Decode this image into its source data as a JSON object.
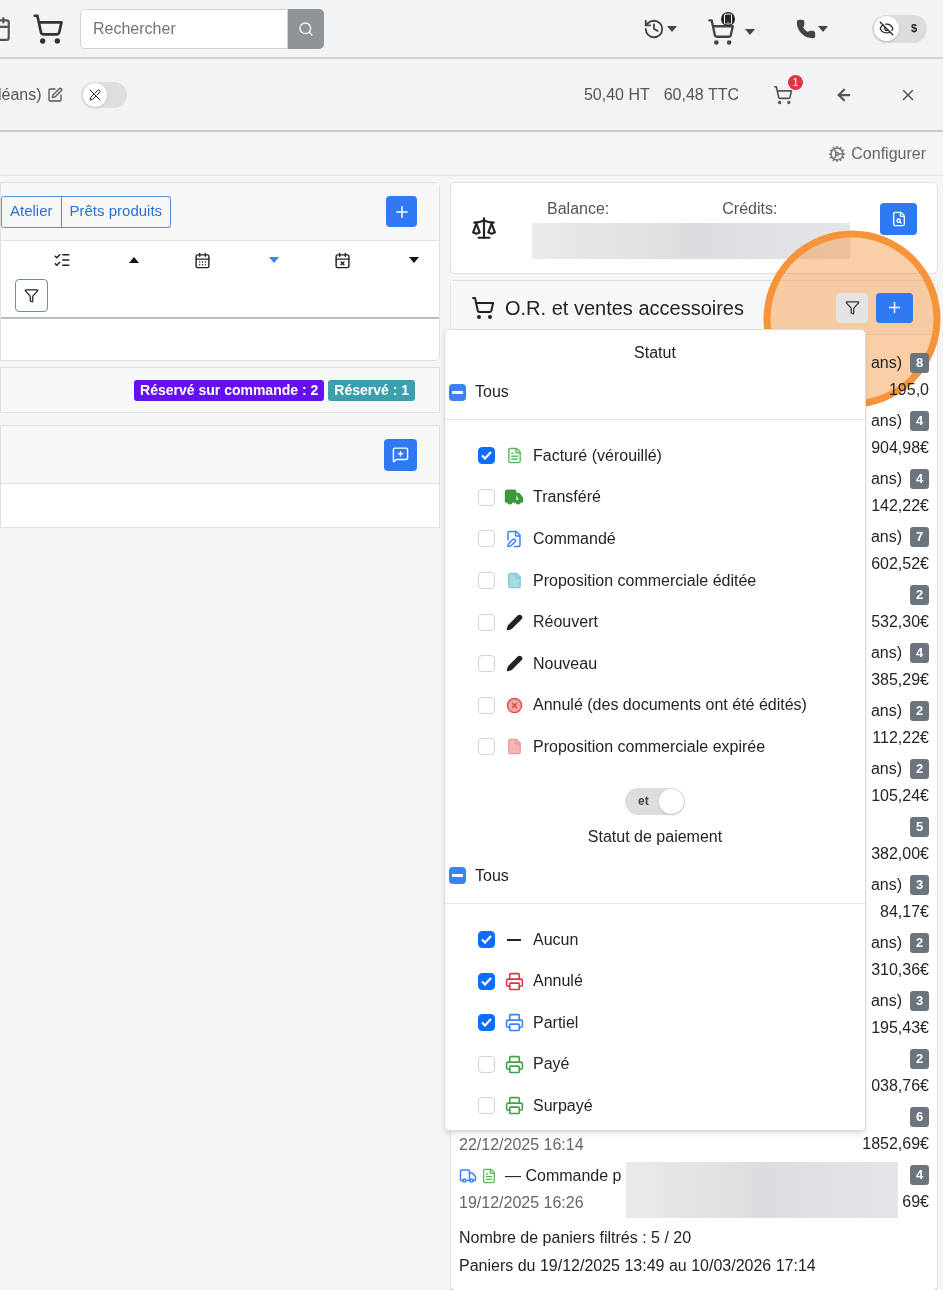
{
  "topbar": {
    "search": {
      "placeholder": "Rechercher"
    },
    "price_toggle": {
      "label": "$",
      "on": false
    }
  },
  "cart_bar": {
    "customer_tail": "léans)",
    "switch": {
      "on": false
    },
    "totals": [
      "50,40 HT",
      "60,48 TTC"
    ],
    "cart_count": "1"
  },
  "config_bar": {
    "label": "Configurer"
  },
  "left": {
    "tabs": [
      {
        "label": "Atelier",
        "selected": false
      },
      {
        "label": "Prêts produits",
        "selected": false
      }
    ],
    "sort_fields": [
      {
        "kind": "checklist",
        "descending": false,
        "selected": false
      },
      {
        "kind": "calendar",
        "descending": true,
        "selected": true
      },
      {
        "kind": "calendar-alert",
        "descending": true,
        "selected": false
      }
    ],
    "badges": [
      {
        "label": "Réservé sur commande : 2",
        "color": "#6610f2"
      },
      {
        "label": "Réservé : 1",
        "color": "#3d9fae"
      }
    ]
  },
  "balance": {
    "labels": [
      "Balance:",
      "Crédits:"
    ]
  },
  "orders": {
    "title": "O.R. et ventes accessoires",
    "rows": [
      {
        "tail": "ans)",
        "count": "8",
        "amount": "195,0"
      },
      {
        "tail": "ans)",
        "count": "4",
        "amount": "904,98€"
      },
      {
        "tail": "ans)",
        "count": "4",
        "amount": "142,22€"
      },
      {
        "tail": "ans)",
        "count": "7",
        "amount": "602,52€"
      },
      {
        "count": "2",
        "amount": "532,30€"
      },
      {
        "tail": "ans)",
        "count": "4",
        "amount": "385,29€"
      },
      {
        "tail": "ans)",
        "count": "2",
        "amount": "112,22€"
      },
      {
        "tail": "ans)",
        "count": "2",
        "amount": "105,24€"
      },
      {
        "count": "5",
        "amount": "382,00€"
      },
      {
        "tail": "ans)",
        "count": "3",
        "amount": "84,17€"
      },
      {
        "tail": "ans)",
        "count": "2",
        "amount": "310,36€"
      },
      {
        "tail": "ans)",
        "count": "3",
        "amount": "195,43€"
      },
      {
        "count": "2",
        "amount": "038,76€"
      },
      {
        "count": "6",
        "date": "22/12/2025 16:14",
        "amount": "1852,69€"
      },
      {
        "title": "— Commande p",
        "count": "4",
        "date": "19/12/2025 16:26",
        "amount": "69€"
      }
    ],
    "footer": [
      "Nombre de paniers filtrés : 5 / 20",
      "Paniers du 19/12/2025 13:49 au 10/03/2026 17:14"
    ]
  },
  "filter_popover": {
    "sections": [
      {
        "title": "Statut",
        "all_label": "Tous",
        "indeterminate": true,
        "items": [
          {
            "label": "Facturé (vérouillé)",
            "kind": "invoice",
            "checked": true
          },
          {
            "label": "Transféré",
            "kind": "truck",
            "checked": false
          },
          {
            "label": "Commandé",
            "kind": "order",
            "checked": false
          },
          {
            "label": "Proposition commerciale éditée",
            "kind": "proposal",
            "checked": false
          },
          {
            "label": "Réouvert",
            "kind": "pencil",
            "checked": false
          },
          {
            "label": "Nouveau",
            "kind": "pencil",
            "checked": false
          },
          {
            "label": "Annulé (des documents ont été édités)",
            "kind": "cancelled",
            "checked": false
          },
          {
            "label": "Proposition commerciale expirée",
            "kind": "expired",
            "checked": false
          }
        ]
      },
      {
        "title": "Statut de paiement",
        "all_label": "Tous",
        "indeterminate": true,
        "items": [
          {
            "label": "Aucun",
            "kind": "dash",
            "checked": true
          },
          {
            "label": "Annulé",
            "kind": "register-cancel",
            "checked": true
          },
          {
            "label": "Partiel",
            "kind": "register-partial",
            "checked": true
          },
          {
            "label": "Payé",
            "kind": "register-paid",
            "checked": false
          },
          {
            "label": "Surpayé",
            "kind": "register-over",
            "checked": false
          }
        ]
      }
    ],
    "join_toggle": {
      "label": "et"
    }
  }
}
